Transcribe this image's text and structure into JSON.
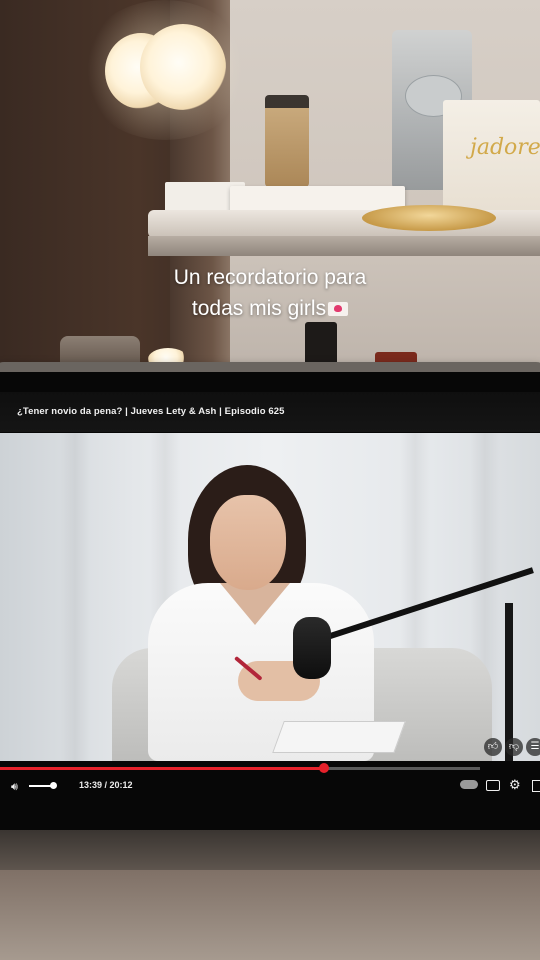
{
  "caption": {
    "line1": "Un recordatorio para",
    "line2": "todas mis girls",
    "emoji": "love-letter-emoji"
  },
  "background": {
    "box_text": "jadore"
  },
  "player": {
    "title": "¿Tener novio da pena? | Jueves Lety & Ash | Episodio 625",
    "time_display": "13:39 / 20:12",
    "progress_fraction": 0.675,
    "accent_color": "#e6212b",
    "controls": {
      "volume_icon": "volume-icon",
      "autoplay_icon": "autoplay-toggle-icon",
      "subtitles_icon": "subtitles-icon",
      "settings_icon": "gear-icon",
      "miniplayer_icon": "miniplayer-icon"
    },
    "side_actions": [
      "like-icon",
      "dislike-icon",
      "comment-icon"
    ]
  }
}
